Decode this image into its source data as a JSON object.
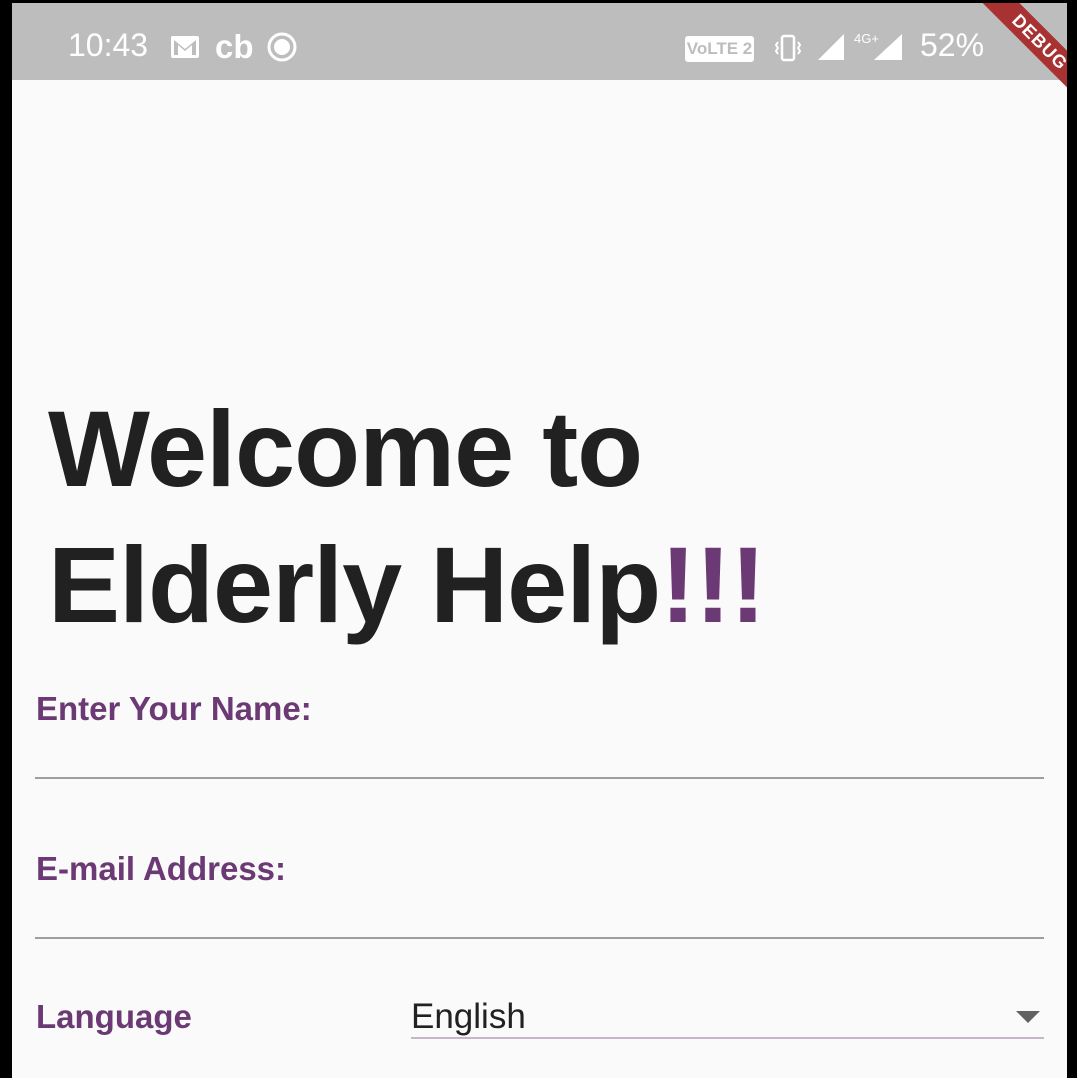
{
  "status_bar": {
    "time": "10:43",
    "carrier_badge": "cb",
    "volte_label": "VoLTE 2",
    "network_type": "4G+",
    "battery": "52%",
    "icons": [
      "gmail-icon",
      "record-icon",
      "vibrate-icon",
      "signal-icon",
      "signal-icon",
      "battery-icon"
    ]
  },
  "debug_banner": "DEBUG",
  "header": {
    "title_main": "Welcome to Elderly Help",
    "title_accent": "!!!"
  },
  "form": {
    "name_label": "Enter Your Name:",
    "name_value": "",
    "email_label": "E-mail Address:",
    "email_value": "",
    "language_label": "Language",
    "language_selected": "English"
  },
  "colors": {
    "accent": "#6b3a74",
    "status_bar": "#bdbdbd",
    "background": "#fafafa",
    "text": "#212121",
    "debug_banner": "#a83232"
  }
}
